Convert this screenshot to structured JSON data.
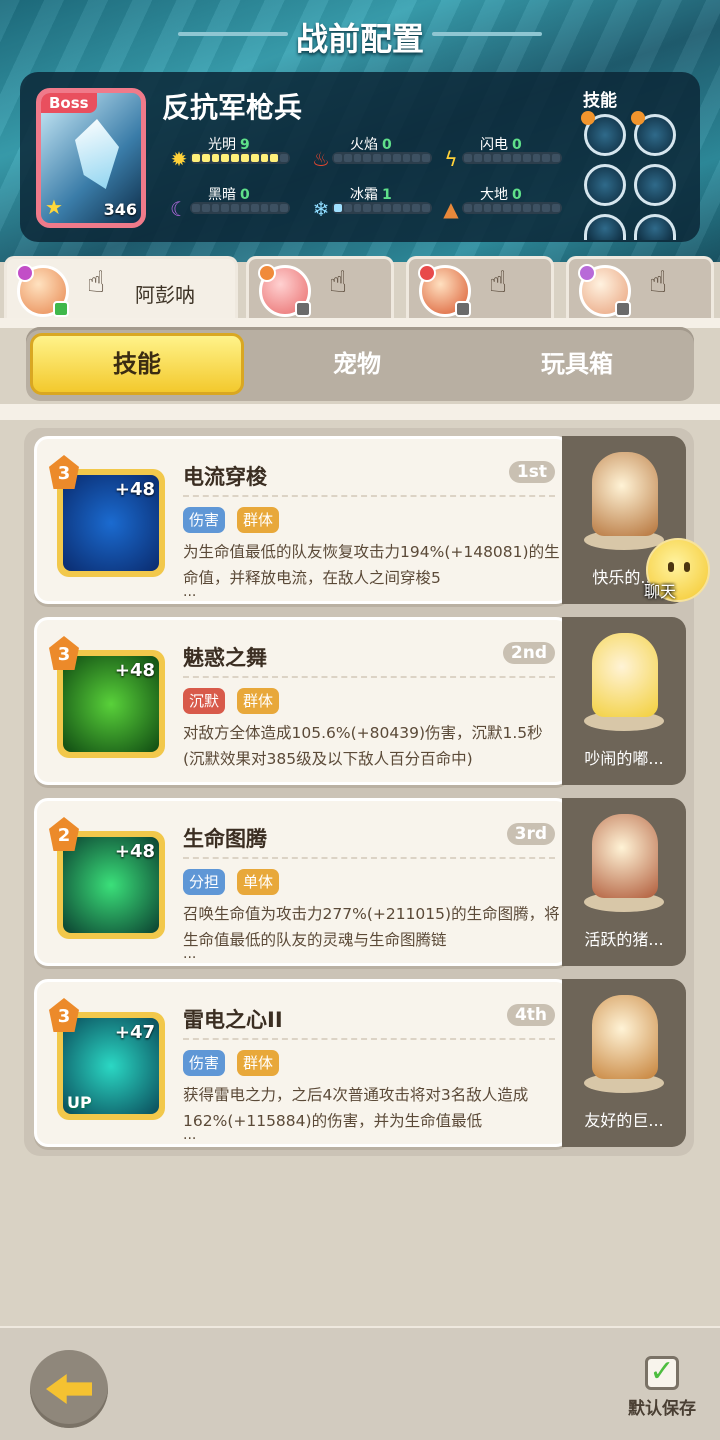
{
  "header": {
    "title": "战前配置"
  },
  "hero": {
    "name": "反抗军枪兵",
    "boss_label": "Boss",
    "power": "346",
    "skills_label": "技能",
    "elements": [
      {
        "name": "光明",
        "value": "9",
        "icon": "sun-icon",
        "level": 9,
        "max": 10
      },
      {
        "name": "火焰",
        "value": "0",
        "icon": "flame-icon",
        "level": 0,
        "max": 10
      },
      {
        "name": "闪电",
        "value": "0",
        "icon": "lightning-icon",
        "level": 0,
        "max": 10
      },
      {
        "name": "黑暗",
        "value": "0",
        "icon": "moon-icon",
        "level": 0,
        "max": 10
      },
      {
        "name": "冰霜",
        "value": "1",
        "icon": "snowflake-icon",
        "level": 1,
        "max": 10
      },
      {
        "name": "大地",
        "value": "0",
        "icon": "earth-icon",
        "level": 0,
        "max": 10
      }
    ]
  },
  "hero_tabs": [
    {
      "name": "阿彭呐",
      "active": true
    },
    {
      "name": "",
      "active": false
    },
    {
      "name": "",
      "active": false
    },
    {
      "name": "",
      "active": false
    }
  ],
  "sub_tabs": {
    "skills": "技能",
    "pets": "宠物",
    "toybox": "玩具箱",
    "active": "skills"
  },
  "skills": [
    {
      "name": "电流穿梭",
      "order": "1st",
      "rank": "3",
      "plus": "+48",
      "tags": [
        {
          "text": "伤害",
          "color": "#5f97d6"
        },
        {
          "text": "群体",
          "color": "#e8a83a"
        }
      ],
      "desc": "为生命值最低的队友恢复攻击力194%(+148081)的生命值，并释放电流，在敌人之间穿梭5",
      "more": "...",
      "icon_colors": [
        "#1b6bd0",
        "#0a2b6e"
      ],
      "up": ""
    },
    {
      "name": "魅惑之舞",
      "order": "2nd",
      "rank": "3",
      "plus": "+48",
      "tags": [
        {
          "text": "沉默",
          "color": "#d85a4a"
        },
        {
          "text": "群体",
          "color": "#e8a83a"
        }
      ],
      "desc": "对敌方全体造成105.6%(+80439)伤害，沉默1.5秒(沉默效果对385级及以下敌人百分百命中)",
      "more": "",
      "icon_colors": [
        "#59d13a",
        "#0f4a12"
      ],
      "up": ""
    },
    {
      "name": "生命图腾",
      "order": "3rd",
      "rank": "2",
      "plus": "+48",
      "tags": [
        {
          "text": "分担",
          "color": "#5f97d6"
        },
        {
          "text": "单体",
          "color": "#e8a83a"
        }
      ],
      "desc": "召唤生命值为攻击力277%(+211015)的生命图腾，将生命值最低的队友的灵魂与生命图腾链",
      "more": "...",
      "icon_colors": [
        "#3be07a",
        "#0b4030"
      ],
      "up": ""
    },
    {
      "name": "雷电之心II",
      "order": "4th",
      "rank": "3",
      "plus": "+47",
      "tags": [
        {
          "text": "伤害",
          "color": "#5f97d6"
        },
        {
          "text": "群体",
          "color": "#e8a83a"
        }
      ],
      "desc": "获得雷电之力，之后4次普通攻击将对3名敌人造成162%(+115884)的伤害，并为生命值最低",
      "more": "...",
      "icon_colors": [
        "#2bd8c4",
        "#0a4b5a"
      ],
      "up": "UP"
    }
  ],
  "pets": [
    {
      "name": "快乐的...",
      "color": "#b5733a"
    },
    {
      "name": "吵闹的嘟...",
      "color": "#f2cf3a"
    },
    {
      "name": "活跃的猪...",
      "color": "#b05b3a"
    },
    {
      "name": "友好的巨...",
      "color": "#c6823a"
    }
  ],
  "chat": {
    "label": "聊天"
  },
  "footer": {
    "save_label": "默认保存",
    "back_icon": "back-arrow-icon"
  }
}
